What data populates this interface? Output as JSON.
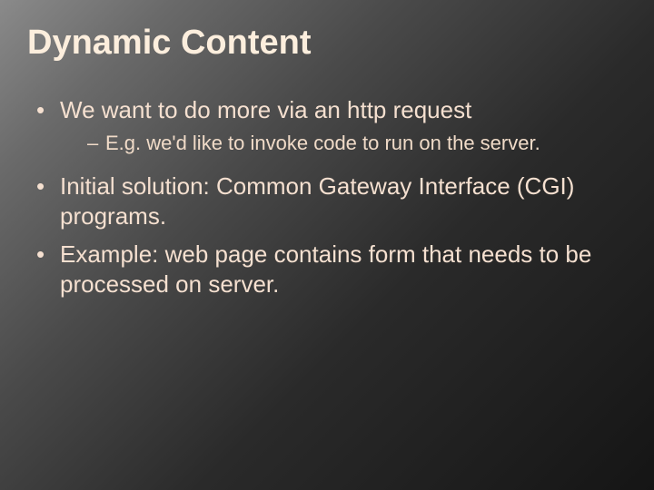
{
  "slide": {
    "title": "Dynamic Content",
    "bullets": [
      {
        "text": "We want to do more via an http request",
        "sub": [
          "E.g. we'd like to invoke code to run on the server."
        ]
      },
      {
        "text": "Initial solution:  Common Gateway Interface (CGI) programs."
      },
      {
        "text": "Example: web page contains form that needs to be processed on server."
      }
    ]
  }
}
